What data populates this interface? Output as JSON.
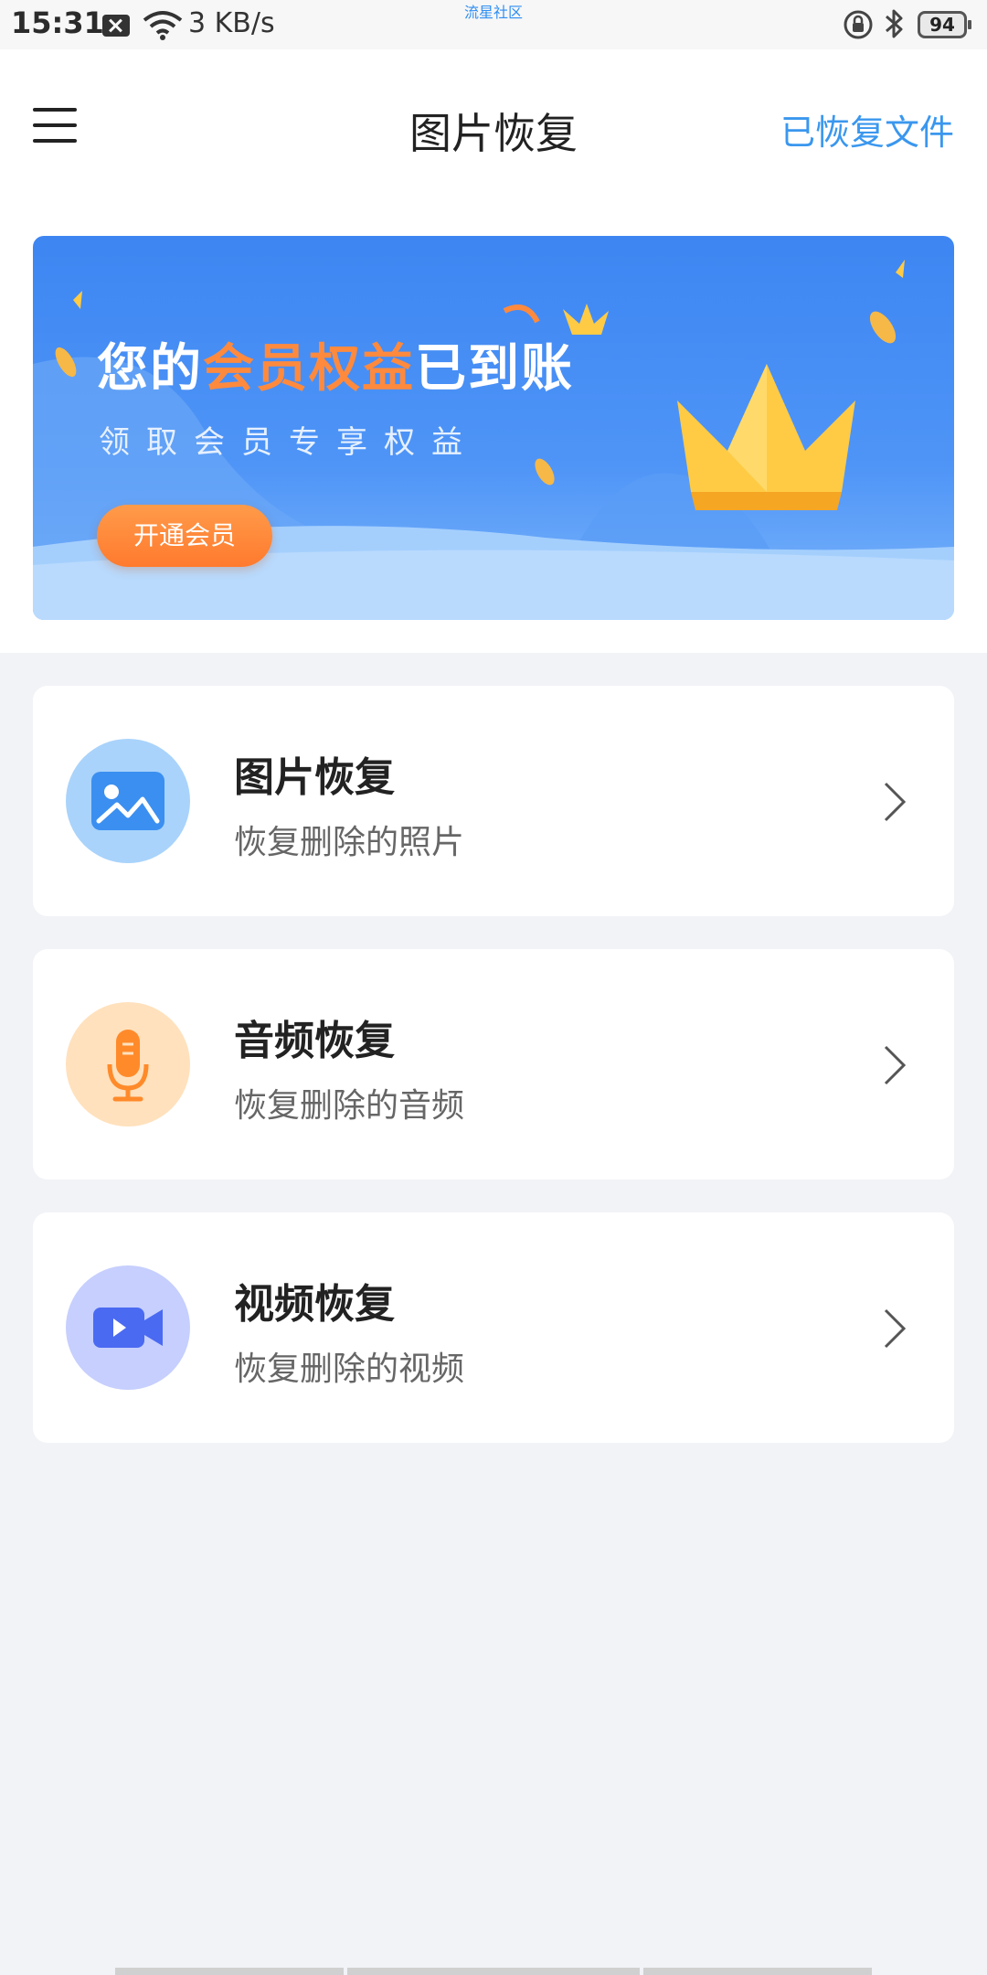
{
  "status_bar": {
    "time": "15:31",
    "speed": "3 KB/s",
    "carrier_label": "流星社区",
    "battery": "94"
  },
  "header": {
    "title": "图片恢复",
    "recovered_link": "已恢复文件"
  },
  "banner": {
    "title_prefix": "您的",
    "title_highlight": "会员权益",
    "title_suffix": "已到账",
    "subtitle": "领取会员专享权益",
    "button_label": "开通会员"
  },
  "cards": [
    {
      "title": "图片恢复",
      "subtitle": "恢复删除的照片",
      "icon": "image-icon",
      "circle_color": "#a9d3fb",
      "icon_color": "#3b8ff0"
    },
    {
      "title": "音频恢复",
      "subtitle": "恢复删除的音频",
      "icon": "microphone-icon",
      "circle_color": "#ffe1bd",
      "icon_color": "#ff8a2a"
    },
    {
      "title": "视频恢复",
      "subtitle": "恢复删除的视频",
      "icon": "video-camera-icon",
      "circle_color": "#c6cffd",
      "icon_color": "#4a6af2"
    }
  ]
}
